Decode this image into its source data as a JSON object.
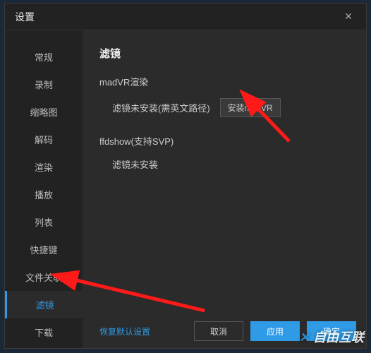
{
  "window": {
    "title": "设置",
    "close_icon": "×"
  },
  "sidebar": {
    "items": [
      {
        "label": "常规"
      },
      {
        "label": "录制"
      },
      {
        "label": "缩略图"
      },
      {
        "label": "解码"
      },
      {
        "label": "渲染"
      },
      {
        "label": "播放"
      },
      {
        "label": "列表"
      },
      {
        "label": "快捷键"
      },
      {
        "label": "文件关联"
      },
      {
        "label": "滤镜",
        "selected": true
      },
      {
        "label": "下载"
      }
    ]
  },
  "content": {
    "title": "滤镜",
    "madvr": {
      "label": "madVR渲染",
      "status": "滤镜未安装(需英文路径)",
      "install_button": "安装madVR"
    },
    "ffdshow": {
      "label": "ffdshow(支持SVP)",
      "status": "滤镜未安装"
    }
  },
  "footer": {
    "reset_link": "恢复默认设置",
    "cancel": "取消",
    "apply": "应用",
    "ok": "确定"
  },
  "watermark": {
    "prefix": "✕",
    "text": "自由互联"
  }
}
